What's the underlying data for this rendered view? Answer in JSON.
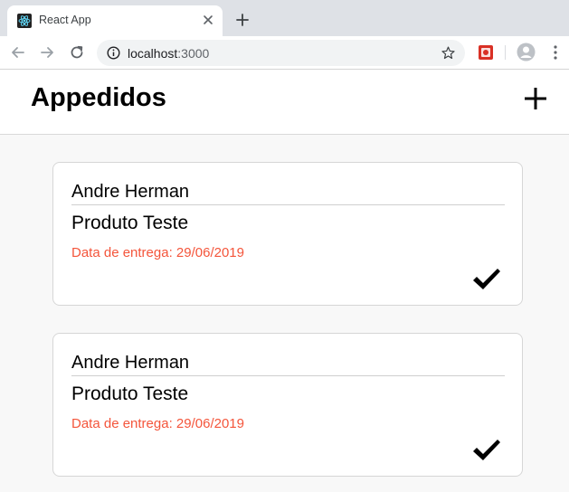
{
  "browser": {
    "tab_title": "React App",
    "url_host": "localhost",
    "url_port": ":3000"
  },
  "app": {
    "title": "Appedidos"
  },
  "orders": [
    {
      "customer": "Andre Herman",
      "product": "Produto Teste",
      "delivery": "Data de entrega: 29/06/2019"
    },
    {
      "customer": "Andre Herman",
      "product": "Produto Teste",
      "delivery": "Data de entrega: 29/06/2019"
    }
  ],
  "colors": {
    "accent_date": "#f4553b",
    "background": "#f8f8f8"
  },
  "icons": [
    "react-icon",
    "close-icon",
    "plus-icon",
    "back-arrow-icon",
    "forward-arrow-icon",
    "reload-icon",
    "info-icon",
    "star-icon",
    "extension-icon",
    "profile-icon",
    "kebab-menu-icon",
    "add-icon",
    "check-icon"
  ]
}
